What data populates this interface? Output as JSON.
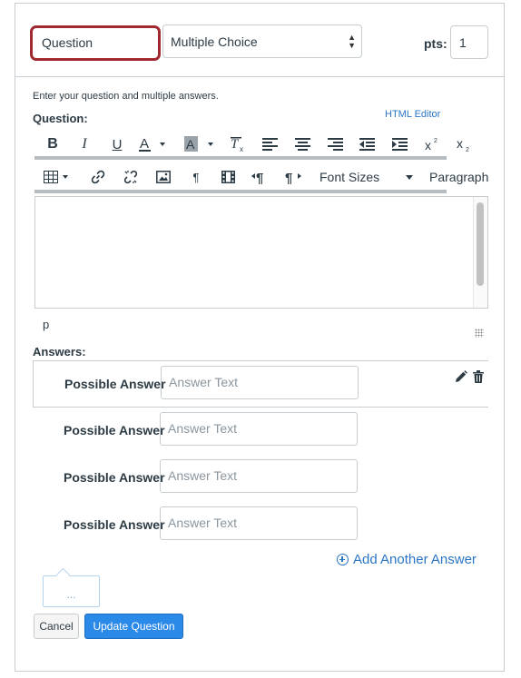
{
  "header": {
    "question_name": "Question",
    "question_type": "Multiple Choice",
    "points_label": "pts:",
    "points_value": "1"
  },
  "instructions": "Enter your question and multiple answers.",
  "question_label": "Question:",
  "html_editor_link": "HTML Editor",
  "toolbar": {
    "row1": [
      "bold-icon",
      "italic-icon",
      "underline-icon",
      "text-color-icon",
      "background-color-icon",
      "clear-formatting-icon",
      "align-left-icon",
      "align-center-icon",
      "align-right-icon",
      "outdent-icon",
      "indent-icon",
      "superscript-icon",
      "subscript-icon"
    ],
    "row2": [
      "table-icon",
      "link-icon",
      "unlink-icon",
      "image-icon",
      "paragraph-mark-icon",
      "media-icon",
      "ltr-icon",
      "rtl-icon"
    ],
    "font_sizes": "Font Sizes",
    "paragraph": "Paragraph"
  },
  "editor": {
    "path": "p"
  },
  "answers_label": "Answers:",
  "answers": [
    {
      "label": "Possible Answer",
      "placeholder": "Answer Text"
    },
    {
      "label": "Possible Answer",
      "placeholder": "Answer Text"
    },
    {
      "label": "Possible Answer",
      "placeholder": "Answer Text"
    },
    {
      "label": "Possible Answer",
      "placeholder": "Answer Text"
    }
  ],
  "add_answer": "Add Another Answer",
  "comment_placeholder": "...",
  "buttons": {
    "cancel": "Cancel",
    "update": "Update Question"
  },
  "colors": {
    "accent": "#2a75c4",
    "primary_button": "#2b89e8",
    "focus_border": "#a0282f"
  }
}
